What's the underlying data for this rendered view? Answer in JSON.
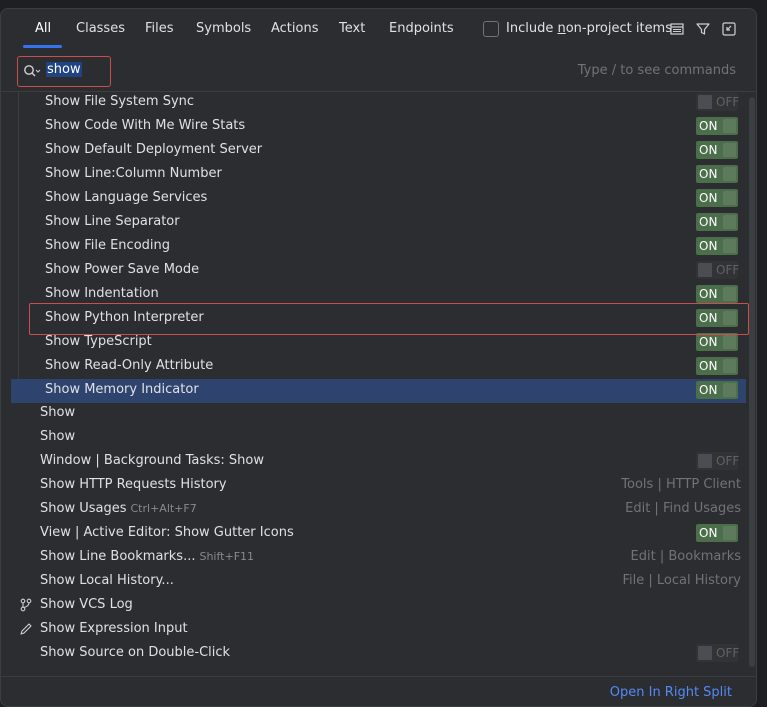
{
  "tabs": [
    {
      "label": "All"
    },
    {
      "label": "Classes"
    },
    {
      "label": "Files"
    },
    {
      "label": "Symbols"
    },
    {
      "label": "Actions"
    },
    {
      "label": "Text"
    },
    {
      "label": "Endpoints"
    }
  ],
  "include_non_project": {
    "prefix": "Include ",
    "underlined": "n",
    "suffix": "on-project items",
    "checked": false
  },
  "toolbar_icons": [
    "preview-panel-icon",
    "filter-icon",
    "open-in-window-icon"
  ],
  "search": {
    "value": "show",
    "hint": "Type / to see commands"
  },
  "items": [
    {
      "label": "Show File System Sync",
      "toggle": "OFF"
    },
    {
      "label": "Show Code With Me Wire Stats",
      "toggle": "ON"
    },
    {
      "label": "Show Default Deployment Server",
      "toggle": "ON"
    },
    {
      "label": "Show Line:Column Number",
      "toggle": "ON"
    },
    {
      "label": "Show Language Services",
      "toggle": "ON"
    },
    {
      "label": "Show Line Separator",
      "toggle": "ON"
    },
    {
      "label": "Show File Encoding",
      "toggle": "ON"
    },
    {
      "label": "Show Power Save Mode",
      "toggle": "OFF"
    },
    {
      "label": "Show Indentation",
      "toggle": "ON"
    },
    {
      "label": "Show Python Interpreter",
      "toggle": "ON"
    },
    {
      "label": "Show TypeScript",
      "toggle": "ON"
    },
    {
      "label": "Show Read-Only Attribute",
      "toggle": "ON"
    },
    {
      "label": "Show Memory Indicator",
      "toggle": "ON",
      "selected": true
    },
    {
      "label": "Show"
    },
    {
      "label": "Show"
    },
    {
      "label": "Window | Background Tasks: Show",
      "toggle": "OFF"
    },
    {
      "label": "Show HTTP Requests History",
      "right": "Tools | HTTP Client"
    },
    {
      "label": "Show Usages",
      "shortcut": "Ctrl+Alt+F7",
      "right": "Edit | Find Usages"
    },
    {
      "label": "View | Active Editor: Show Gutter Icons",
      "toggle": "ON"
    },
    {
      "label": "Show Line Bookmarks...",
      "shortcut": "Shift+F11",
      "right": "Edit | Bookmarks"
    },
    {
      "label": "Show Local History...",
      "right": "File | Local History"
    },
    {
      "label": "Show VCS Log",
      "icon": "vcs-branch-icon"
    },
    {
      "label": "Show Expression Input",
      "icon": "pencil-icon"
    },
    {
      "label": "Show Source on Double-Click",
      "toggle": "OFF"
    }
  ],
  "footer": {
    "link": "Open In Right Split"
  }
}
